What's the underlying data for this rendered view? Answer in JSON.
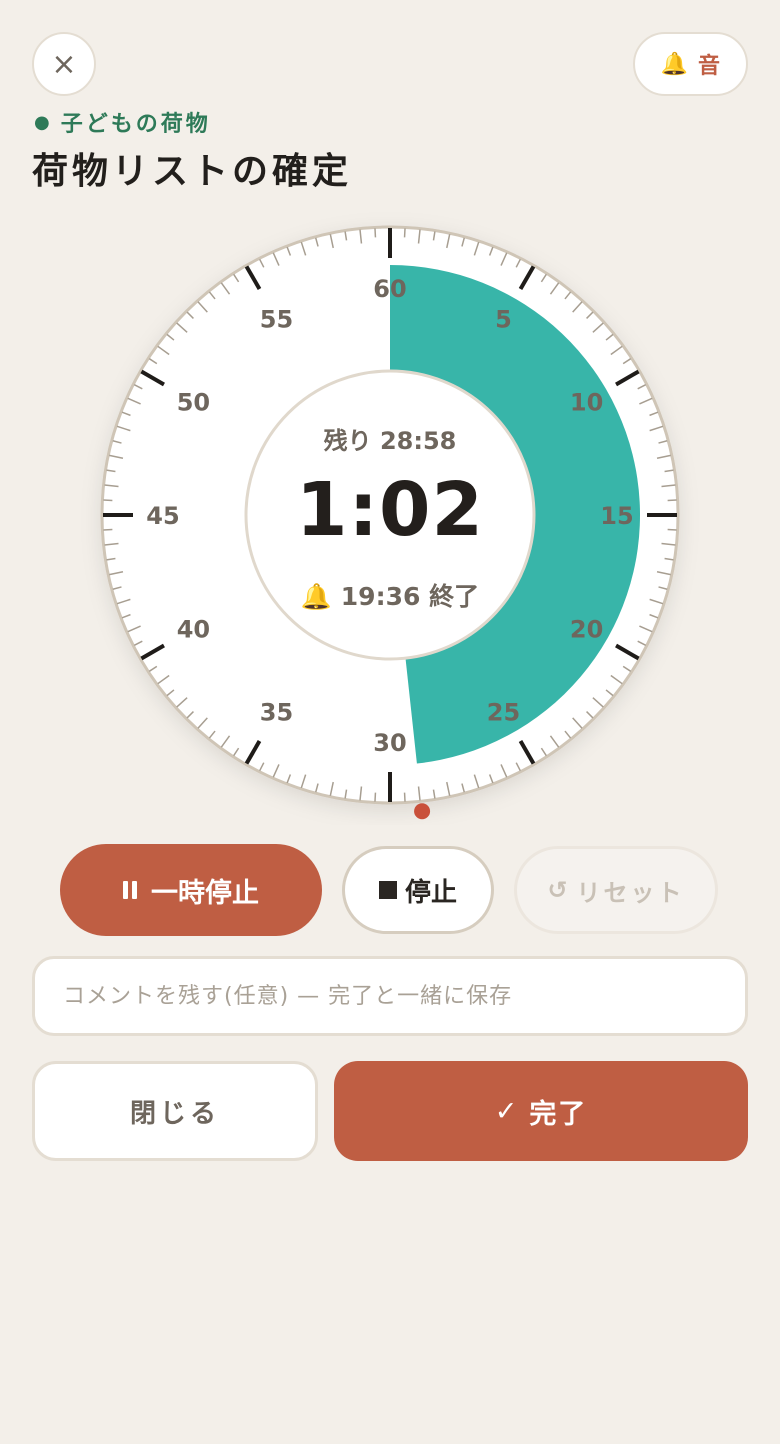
{
  "header": {
    "close_icon": "×",
    "sound_icon": "🔔",
    "sound_label": "音"
  },
  "task": {
    "category": "子どもの荷物",
    "category_dot": "●",
    "title": "荷物リストの確定"
  },
  "dial": {
    "labels": [
      "60",
      "5",
      "10",
      "15",
      "20",
      "25",
      "30",
      "35",
      "40",
      "45",
      "50",
      "55"
    ],
    "remaining_minutes": 28.97,
    "accent": "#38b5a9",
    "marker": "#c9503a"
  },
  "timer": {
    "remaining": "残り 28:58",
    "elapsed": "1:02",
    "end_icon": "🔔",
    "end_time": "19:36 終了"
  },
  "controls": {
    "pause_label": "一時停止",
    "stop_label": "停止",
    "reset_icon": "↺",
    "reset_label": "リセット"
  },
  "comment": {
    "placeholder": "コメントを残す(任意) — 完了と一緒に保存",
    "value": ""
  },
  "footer": {
    "close_label": "閉じる",
    "done_icon": "✓",
    "done_label": "完了"
  },
  "colors": {
    "background": "#f3efe9",
    "primary": "#bf5e43",
    "category": "#2e7a58"
  }
}
